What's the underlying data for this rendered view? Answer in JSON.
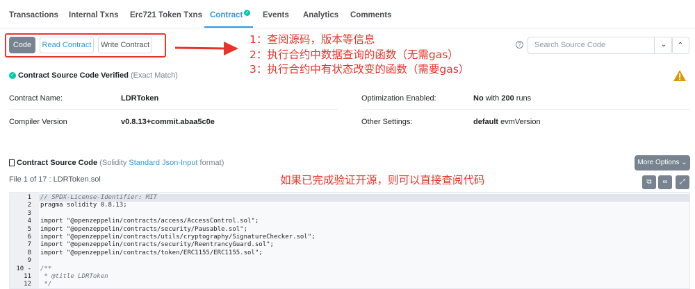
{
  "tabs": [
    {
      "label": "Transactions"
    },
    {
      "label": "Internal Txns"
    },
    {
      "label": "Erc721 Token Txns"
    },
    {
      "label": "Contract"
    },
    {
      "label": "Events"
    },
    {
      "label": "Analytics"
    },
    {
      "label": "Comments"
    }
  ],
  "buttons": {
    "code": "Code",
    "read": "Read Contract",
    "write": "Write Contract"
  },
  "annotations": [
    "1：查阅源码，版本等信息",
    "2：执行合约中数据查询的函数（无需gas）",
    "3：执行合约中有状态改变的函数（需要gas）",
    "如果已完成验证开源，则可以直接查阅代码"
  ],
  "search": {
    "placeholder": "Search Source Code"
  },
  "verified": {
    "title": "Contract Source Code Verified",
    "sub": "(Exact Match)"
  },
  "info": {
    "name_label": "Contract Name:",
    "name_value": "LDRToken",
    "compiler_label": "Compiler Version",
    "compiler_value": "v0.8.13+commit.abaa5c0e",
    "opt_label": "Optimization Enabled:",
    "opt_value_bold": "No",
    "opt_with": "with",
    "opt_runs_bold": "200",
    "opt_runs": "runs",
    "other_label": "Other Settings:",
    "other_value_bold": "default",
    "other_value": "evmVersion"
  },
  "source": {
    "title": "Contract Source Code",
    "pre": "(Solidity",
    "link": "Standard Json-Input",
    "post": "format)",
    "more_options": "More Options",
    "file_of": "File 1 of 17 : LDRToken.sol"
  },
  "code_lines": [
    {
      "n": "1",
      "t": "// SPDX-License-Identifier: MIT",
      "c": true
    },
    {
      "n": "2",
      "t": "pragma solidity 0.8.13;",
      "c": false
    },
    {
      "n": "3",
      "t": "",
      "c": false
    },
    {
      "n": "4",
      "t": "import \"@openzeppelin/contracts/access/AccessControl.sol\";",
      "c": false
    },
    {
      "n": "5",
      "t": "import \"@openzeppelin/contracts/security/Pausable.sol\";",
      "c": false
    },
    {
      "n": "6",
      "t": "import \"@openzeppelin/contracts/utils/cryptography/SignatureChecker.sol\";",
      "c": false
    },
    {
      "n": "7",
      "t": "import \"@openzeppelin/contracts/security/ReentrancyGuard.sol\";",
      "c": false
    },
    {
      "n": "8",
      "t": "import \"@openzeppelin/contracts/token/ERC1155/ERC1155.sol\";",
      "c": false
    },
    {
      "n": "9",
      "t": "",
      "c": false
    },
    {
      "n": "10 -",
      "t": "/**",
      "c": true
    },
    {
      "n": "11",
      "t": " * @title LDRToken",
      "c": true
    },
    {
      "n": "12",
      "t": " */",
      "c": true
    }
  ],
  "colors": {
    "accent": "#3498db",
    "annotation": "#e8342a",
    "verified": "#00c9a7",
    "warning": "#db9a04"
  }
}
